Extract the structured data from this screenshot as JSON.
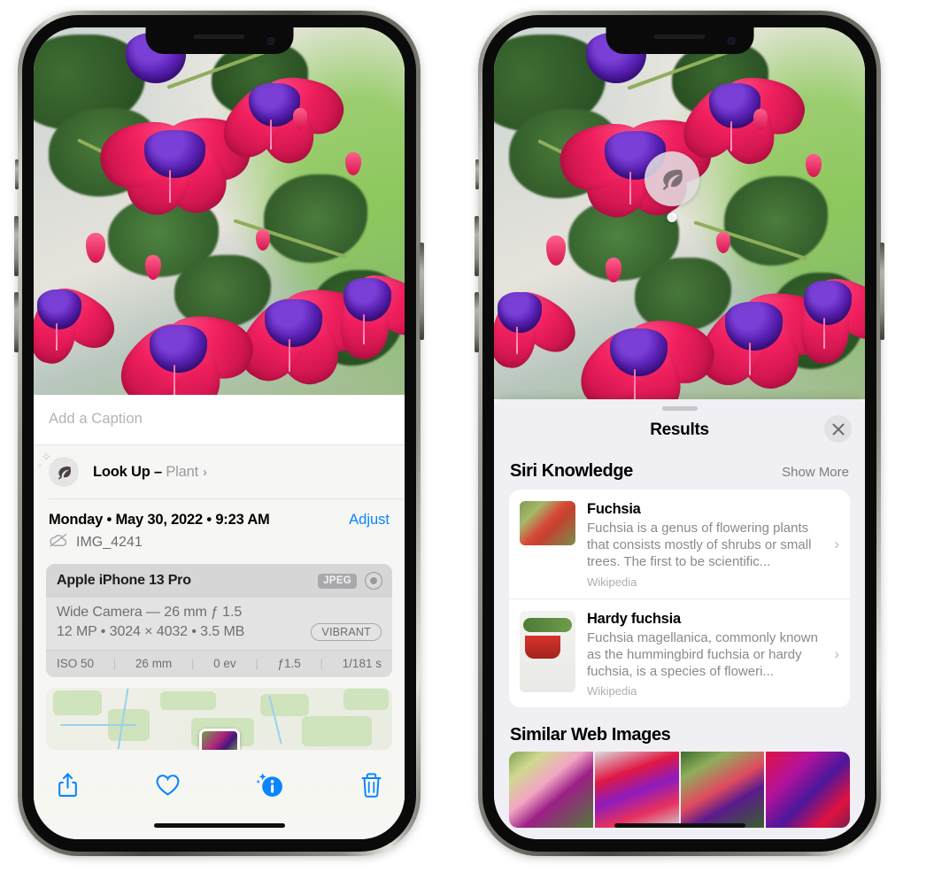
{
  "left_phone": {
    "caption": {
      "placeholder": "Add a Caption",
      "value": ""
    },
    "lookup": {
      "label": "Look Up –",
      "subject": "Plant",
      "chevron": "›",
      "icon": "leaf-icon"
    },
    "metadata": {
      "date": "Monday • May 30, 2022 • 9:23 AM",
      "adjust_label": "Adjust",
      "filename": "IMG_4241",
      "cloud_icon": "icloud-slash-icon"
    },
    "camera_card": {
      "device": "Apple iPhone 13 Pro",
      "format_badge": "JPEG",
      "raw_icon": "aperture-icon",
      "lens_line": "Wide Camera — 26 mm ƒ 1.5",
      "specs_line": "12 MP • 3024 × 4032 • 3.5 MB",
      "style_badge": "VIBRANT",
      "exif": [
        "ISO 50",
        "26 mm",
        "0 ev",
        "ƒ1.5",
        "1/181 s"
      ]
    },
    "toolbar": [
      {
        "name": "share-button",
        "icon": "share-icon"
      },
      {
        "name": "favorite-button",
        "icon": "heart-icon"
      },
      {
        "name": "info-button",
        "icon": "info-sparkle-icon"
      },
      {
        "name": "delete-button",
        "icon": "trash-icon"
      }
    ]
  },
  "right_phone": {
    "badge": {
      "icon": "leaf-icon"
    },
    "sheet": {
      "title": "Results",
      "close_icon": "close-icon"
    },
    "siri_knowledge": {
      "title": "Siri Knowledge",
      "show_more": "Show More",
      "items": [
        {
          "title": "Fuchsia",
          "description": "Fuchsia is a genus of flowering plants that consists mostly of shrubs or small trees. The first to be scientific...",
          "source": "Wikipedia",
          "chevron": "›"
        },
        {
          "title": "Hardy fuchsia",
          "description": "Fuchsia magellanica, commonly known as the hummingbird fuchsia or hardy fuchsia, is a species of floweri...",
          "source": "Wikipedia",
          "chevron": "›"
        }
      ]
    },
    "similar_web_images": {
      "title": "Similar Web Images",
      "count": 4
    }
  },
  "colors": {
    "accent_blue": "#0a84ff",
    "sheet_bg": "#f0eff4",
    "info_bg": "#f6f6f4",
    "card_gray": "#dddddd",
    "secondary_text": "#8a8a8e"
  }
}
